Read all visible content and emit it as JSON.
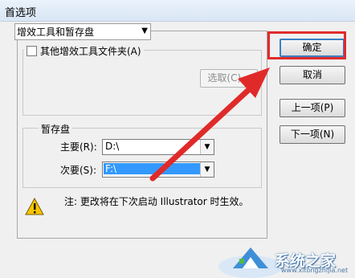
{
  "window": {
    "title": "首选项"
  },
  "section_select": {
    "value": "增效工具和暂存盘"
  },
  "plugins": {
    "checkbox_label": "其他增效工具文件夹(A)",
    "choose_button": "选取(C)..."
  },
  "buttons": {
    "ok": "确定",
    "cancel": "取消",
    "prev": "上一项(P)",
    "next": "下一项(N)"
  },
  "scratch": {
    "legend": "暂存盘",
    "primary_label": "主要(R):",
    "primary_value": "D:\\",
    "secondary_label": "次要(S):",
    "secondary_value": "F:\\"
  },
  "note": {
    "text": "注: 更改将在下次启动 Illustrator 时生效。"
  },
  "watermark": {
    "text": "系统之家",
    "url": "www.xitongzhijia.net"
  },
  "colors": {
    "annotation": "#e02a2a",
    "selection": "#3399ff"
  }
}
